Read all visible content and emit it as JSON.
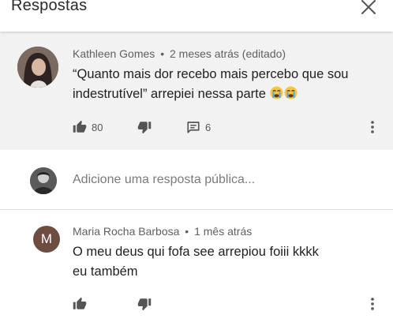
{
  "header": {
    "title": "Respostas",
    "close_icon": "close-icon"
  },
  "parent_comment": {
    "author": "Kathleen Gomes",
    "separator": "•",
    "age": "2 meses atrás (editado)",
    "text": "“Quanto mais dor recebo mais percebo que sou indestrutível” arrepiei nessa parte",
    "emojis": [
      "crying-face-emoji",
      "crying-face-emoji"
    ],
    "likes": "80",
    "replies": "6"
  },
  "reply_box": {
    "placeholder": "Adicione uma resposta pública..."
  },
  "reply": {
    "avatar_letter": "M",
    "author": "Maria Rocha Barbosa",
    "separator": "•",
    "age": "1 mês atrás",
    "text": "O meu deus qui fofa see arrepiou foiii kkkk eu também"
  },
  "colors": {
    "parent_bg": "#f2f2f2",
    "reply_avatar_bg": "#6d4c41",
    "meta_text": "#606060"
  }
}
